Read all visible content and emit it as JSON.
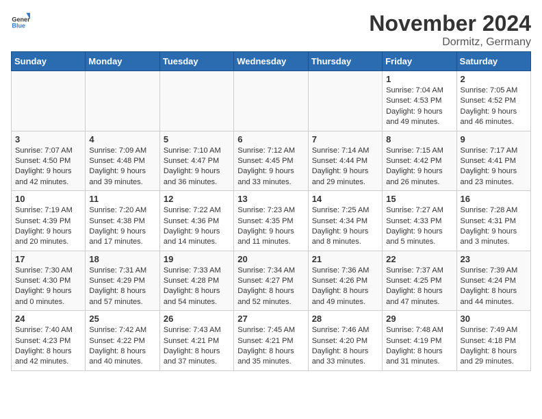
{
  "header": {
    "logo_general": "General",
    "logo_blue": "Blue",
    "month_title": "November 2024",
    "location": "Dormitz, Germany"
  },
  "weekdays": [
    "Sunday",
    "Monday",
    "Tuesday",
    "Wednesday",
    "Thursday",
    "Friday",
    "Saturday"
  ],
  "weeks": [
    [
      {
        "day": "",
        "info": ""
      },
      {
        "day": "",
        "info": ""
      },
      {
        "day": "",
        "info": ""
      },
      {
        "day": "",
        "info": ""
      },
      {
        "day": "",
        "info": ""
      },
      {
        "day": "1",
        "info": "Sunrise: 7:04 AM\nSunset: 4:53 PM\nDaylight: 9 hours and 49 minutes."
      },
      {
        "day": "2",
        "info": "Sunrise: 7:05 AM\nSunset: 4:52 PM\nDaylight: 9 hours and 46 minutes."
      }
    ],
    [
      {
        "day": "3",
        "info": "Sunrise: 7:07 AM\nSunset: 4:50 PM\nDaylight: 9 hours and 42 minutes."
      },
      {
        "day": "4",
        "info": "Sunrise: 7:09 AM\nSunset: 4:48 PM\nDaylight: 9 hours and 39 minutes."
      },
      {
        "day": "5",
        "info": "Sunrise: 7:10 AM\nSunset: 4:47 PM\nDaylight: 9 hours and 36 minutes."
      },
      {
        "day": "6",
        "info": "Sunrise: 7:12 AM\nSunset: 4:45 PM\nDaylight: 9 hours and 33 minutes."
      },
      {
        "day": "7",
        "info": "Sunrise: 7:14 AM\nSunset: 4:44 PM\nDaylight: 9 hours and 29 minutes."
      },
      {
        "day": "8",
        "info": "Sunrise: 7:15 AM\nSunset: 4:42 PM\nDaylight: 9 hours and 26 minutes."
      },
      {
        "day": "9",
        "info": "Sunrise: 7:17 AM\nSunset: 4:41 PM\nDaylight: 9 hours and 23 minutes."
      }
    ],
    [
      {
        "day": "10",
        "info": "Sunrise: 7:19 AM\nSunset: 4:39 PM\nDaylight: 9 hours and 20 minutes."
      },
      {
        "day": "11",
        "info": "Sunrise: 7:20 AM\nSunset: 4:38 PM\nDaylight: 9 hours and 17 minutes."
      },
      {
        "day": "12",
        "info": "Sunrise: 7:22 AM\nSunset: 4:36 PM\nDaylight: 9 hours and 14 minutes."
      },
      {
        "day": "13",
        "info": "Sunrise: 7:23 AM\nSunset: 4:35 PM\nDaylight: 9 hours and 11 minutes."
      },
      {
        "day": "14",
        "info": "Sunrise: 7:25 AM\nSunset: 4:34 PM\nDaylight: 9 hours and 8 minutes."
      },
      {
        "day": "15",
        "info": "Sunrise: 7:27 AM\nSunset: 4:33 PM\nDaylight: 9 hours and 5 minutes."
      },
      {
        "day": "16",
        "info": "Sunrise: 7:28 AM\nSunset: 4:31 PM\nDaylight: 9 hours and 3 minutes."
      }
    ],
    [
      {
        "day": "17",
        "info": "Sunrise: 7:30 AM\nSunset: 4:30 PM\nDaylight: 9 hours and 0 minutes."
      },
      {
        "day": "18",
        "info": "Sunrise: 7:31 AM\nSunset: 4:29 PM\nDaylight: 8 hours and 57 minutes."
      },
      {
        "day": "19",
        "info": "Sunrise: 7:33 AM\nSunset: 4:28 PM\nDaylight: 8 hours and 54 minutes."
      },
      {
        "day": "20",
        "info": "Sunrise: 7:34 AM\nSunset: 4:27 PM\nDaylight: 8 hours and 52 minutes."
      },
      {
        "day": "21",
        "info": "Sunrise: 7:36 AM\nSunset: 4:26 PM\nDaylight: 8 hours and 49 minutes."
      },
      {
        "day": "22",
        "info": "Sunrise: 7:37 AM\nSunset: 4:25 PM\nDaylight: 8 hours and 47 minutes."
      },
      {
        "day": "23",
        "info": "Sunrise: 7:39 AM\nSunset: 4:24 PM\nDaylight: 8 hours and 44 minutes."
      }
    ],
    [
      {
        "day": "24",
        "info": "Sunrise: 7:40 AM\nSunset: 4:23 PM\nDaylight: 8 hours and 42 minutes."
      },
      {
        "day": "25",
        "info": "Sunrise: 7:42 AM\nSunset: 4:22 PM\nDaylight: 8 hours and 40 minutes."
      },
      {
        "day": "26",
        "info": "Sunrise: 7:43 AM\nSunset: 4:21 PM\nDaylight: 8 hours and 37 minutes."
      },
      {
        "day": "27",
        "info": "Sunrise: 7:45 AM\nSunset: 4:21 PM\nDaylight: 8 hours and 35 minutes."
      },
      {
        "day": "28",
        "info": "Sunrise: 7:46 AM\nSunset: 4:20 PM\nDaylight: 8 hours and 33 minutes."
      },
      {
        "day": "29",
        "info": "Sunrise: 7:48 AM\nSunset: 4:19 PM\nDaylight: 8 hours and 31 minutes."
      },
      {
        "day": "30",
        "info": "Sunrise: 7:49 AM\nSunset: 4:18 PM\nDaylight: 8 hours and 29 minutes."
      }
    ]
  ]
}
